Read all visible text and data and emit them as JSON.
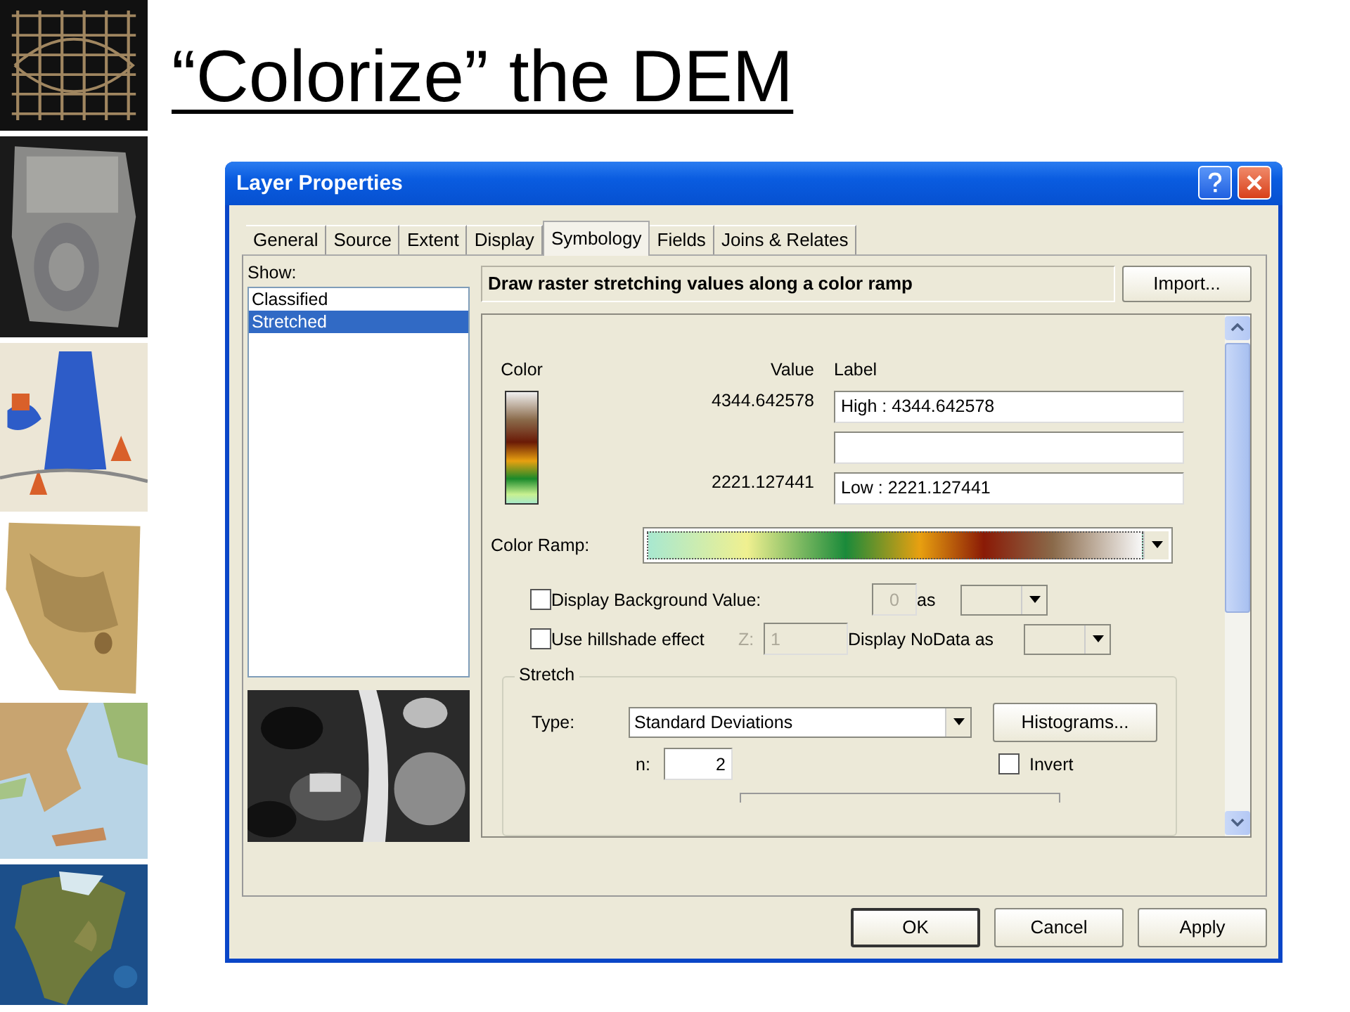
{
  "slide": {
    "title": "“Colorize” the DEM"
  },
  "dialog": {
    "title": "Layer Properties",
    "tabs": [
      {
        "label": "General",
        "selected": false
      },
      {
        "label": "Source",
        "selected": false
      },
      {
        "label": "Extent",
        "selected": false
      },
      {
        "label": "Display",
        "selected": false
      },
      {
        "label": "Symbology",
        "selected": true
      },
      {
        "label": "Fields",
        "selected": false
      },
      {
        "label": "Joins & Relates",
        "selected": false
      }
    ],
    "show_label": "Show:",
    "show_items": [
      {
        "label": "Classified",
        "selected": false
      },
      {
        "label": "Stretched",
        "selected": true
      }
    ],
    "description": "Draw raster stretching values along a color ramp",
    "import_button": "Import...",
    "legend": {
      "color_heading": "Color",
      "value_heading": "Value",
      "label_heading": "Label",
      "high_value": "4344.642578",
      "low_value": "2221.127441",
      "high_label": "High : 4344.642578",
      "low_label": "Low : 2221.127441"
    },
    "color_ramp_label": "Color Ramp:",
    "background_value": {
      "label": "Display Background Value:",
      "checked": false,
      "value": "0",
      "disabled": true,
      "as_label": "as"
    },
    "hillshade": {
      "label": "Use hillshade effect",
      "checked": false,
      "z_label": "Z:",
      "z_value": "1",
      "disabled": true
    },
    "nodata_label": "Display NoData as",
    "stretch": {
      "title": "Stretch",
      "type_label": "Type:",
      "type_value": "Standard Deviations",
      "histograms_button": "Histograms...",
      "n_label": "n:",
      "n_value": "2",
      "invert": {
        "label": "Invert",
        "checked": false
      }
    },
    "buttons": [
      {
        "label": "OK",
        "default": true
      },
      {
        "label": "Cancel",
        "default": false
      },
      {
        "label": "Apply",
        "default": false
      }
    ]
  }
}
